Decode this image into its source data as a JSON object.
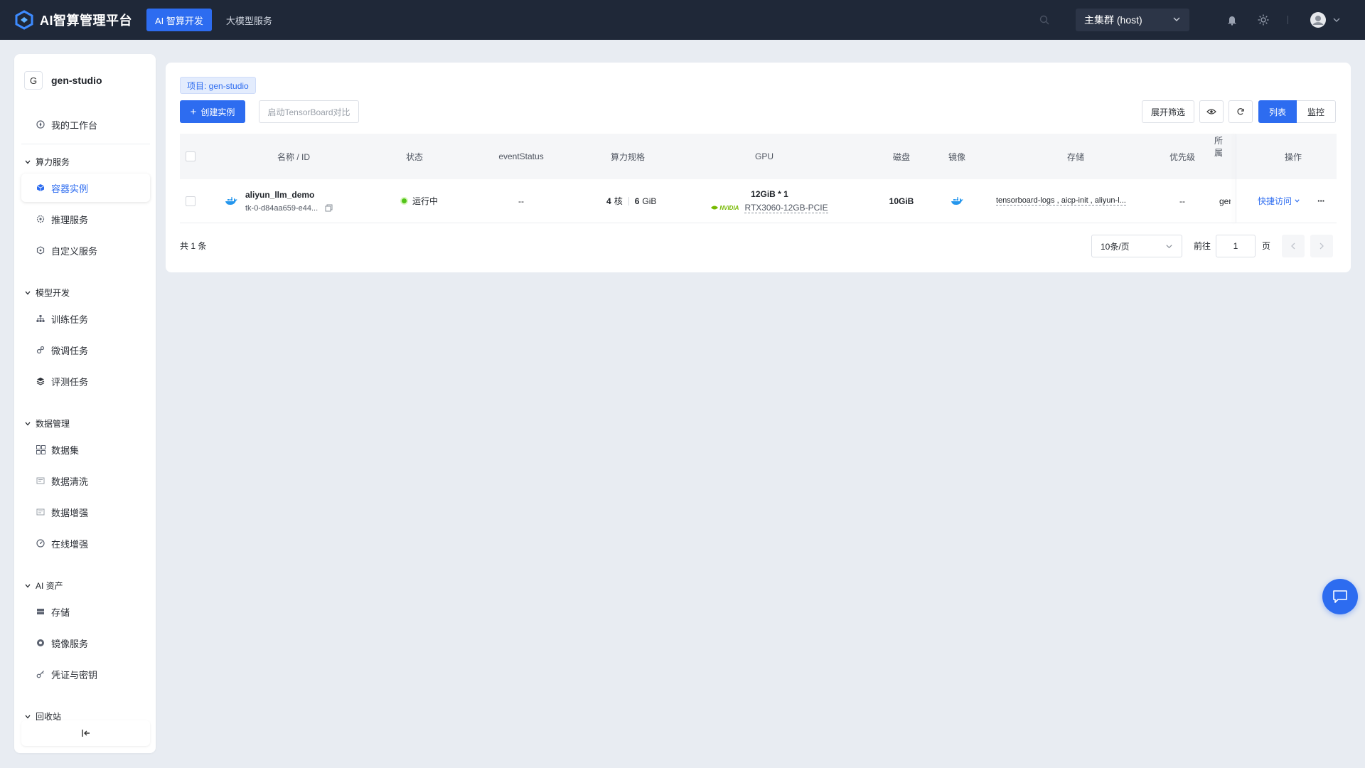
{
  "app": {
    "title": "AI智算管理平台"
  },
  "topnav": {
    "tabs": [
      {
        "label": "AI 智算开发",
        "active": true
      },
      {
        "label": "大模型服务",
        "active": false
      }
    ],
    "cluster": "主集群 (host)"
  },
  "sidebar": {
    "project_initial": "G",
    "project_name": "gen-studio",
    "workspace": "我的工作台",
    "groups": {
      "compute": "算力服务",
      "model": "模型开发",
      "data": "数据管理",
      "assets": "AI 资产",
      "recycle": "回收站"
    },
    "items": {
      "container": "容器实例",
      "inference": "推理服务",
      "custom": "自定义服务",
      "training": "训练任务",
      "finetune": "微调任务",
      "eval": "评测任务",
      "dataset": "数据集",
      "clean": "数据清洗",
      "augment": "数据增强",
      "online_augment": "在线增强",
      "storage": "存储",
      "image": "镜像服务",
      "credential": "凭证与密钥"
    }
  },
  "main": {
    "project_tag": "项目: gen-studio",
    "create_button": "创建实例",
    "tensorboard_button": "启动TensorBoard对比",
    "filter_button": "展开筛选",
    "view_list": "列表",
    "view_monitor": "监控"
  },
  "table": {
    "headers": {
      "name": "名称 / ID",
      "status": "状态",
      "event": "eventStatus",
      "spec": "算力规格",
      "gpu": "GPU",
      "disk": "磁盘",
      "image": "镜像",
      "storage": "存储",
      "priority": "优先级",
      "owner": "所属",
      "ops": "操作"
    },
    "rows": [
      {
        "name": "aliyun_llm_demo",
        "id": "tk-0-d84aa659-e44...",
        "status": "运行中",
        "event": "--",
        "cores": "4",
        "cores_unit": "核",
        "mem": "6",
        "mem_unit": "GiB",
        "gpu_mem": "12GiB * 1",
        "gpu_brand": "NVIDIA",
        "gpu_model": "RTX3060-12GB-PCIE",
        "disk": "10GiB",
        "storage": "tensorboard-logs , aicp-init , aliyun-l...",
        "priority": "--",
        "owner": "gen",
        "quick_access": "快捷访问",
        "more": "···"
      }
    ]
  },
  "pagination": {
    "total": "共 1 条",
    "page_size": "10条/页",
    "goto": "前往",
    "page": "1",
    "page_unit": "页"
  },
  "colors": {
    "primary": "#2d6cf0",
    "topbar": "#1f2838",
    "running": "#52c41a",
    "nvidia": "#76b900"
  }
}
